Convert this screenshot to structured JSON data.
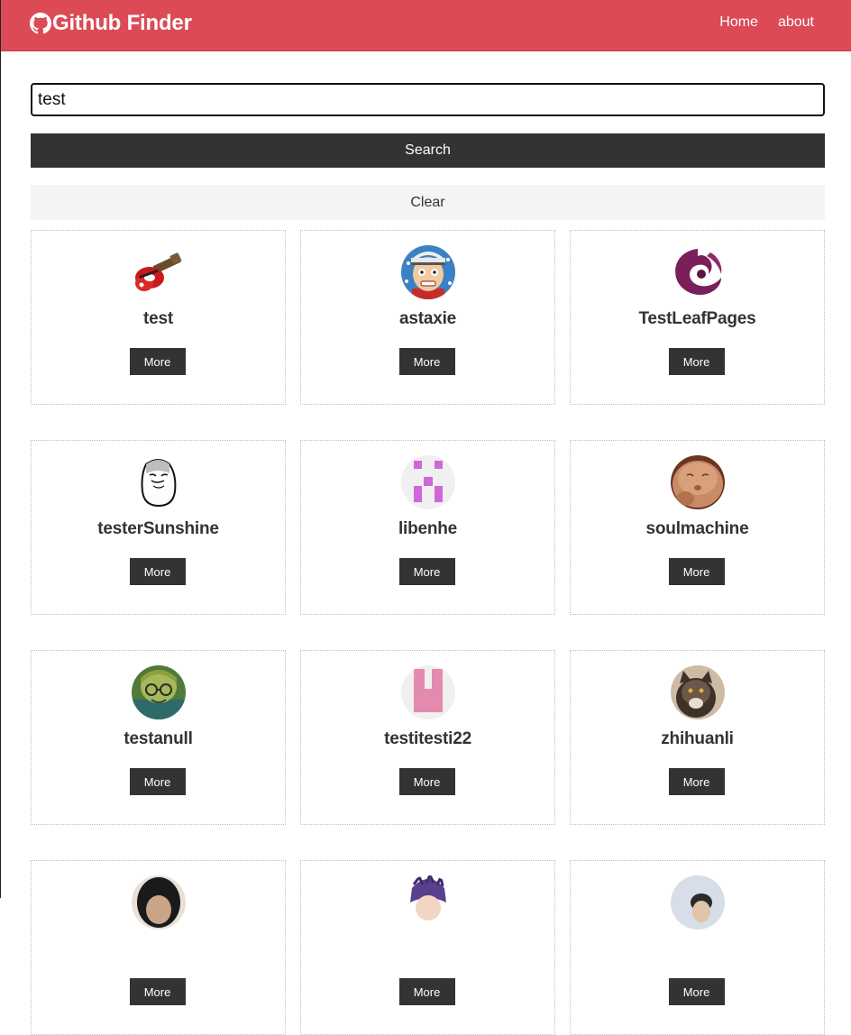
{
  "navbar": {
    "brand_icon": "github-icon",
    "brand_title": "Github Finder",
    "links": [
      {
        "label": "Home"
      },
      {
        "label": "about"
      }
    ],
    "color": "#dc4a56"
  },
  "search": {
    "value": "test",
    "search_label": "Search",
    "clear_label": "Clear"
  },
  "more_label": "More",
  "users": [
    {
      "login": "test",
      "avatar": "guitar-avatar-icon"
    },
    {
      "login": "astaxie",
      "avatar": "cartoon-face-avatar-icon"
    },
    {
      "login": "TestLeafPages",
      "avatar": "swirl-logo-avatar-icon"
    },
    {
      "login": "testerSunshine",
      "avatar": "meme-face-avatar-icon"
    },
    {
      "login": "libenhe",
      "avatar": "identicon-avatar-icon"
    },
    {
      "login": "soulmachine",
      "avatar": "baby-photo-avatar-icon"
    },
    {
      "login": "testanull",
      "avatar": "anime-avatar-icon"
    },
    {
      "login": "testitesti22",
      "avatar": "identicon-avatar-icon"
    },
    {
      "login": "zhihuanli",
      "avatar": "cat-photo-avatar-icon"
    },
    {
      "login": "",
      "avatar": "dark-photo-avatar-icon"
    },
    {
      "login": "",
      "avatar": "purple-hair-avatar-icon"
    },
    {
      "login": "",
      "avatar": "light-photo-avatar-icon"
    }
  ]
}
